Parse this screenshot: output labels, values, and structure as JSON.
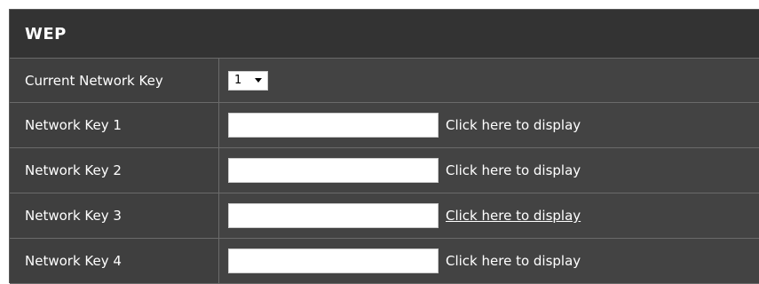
{
  "section": {
    "title": "WEP"
  },
  "current_key": {
    "label": "Current Network Key",
    "selected": "1"
  },
  "keys": [
    {
      "label": "Network Key 1",
      "value": "",
      "link": "Click here to display"
    },
    {
      "label": "Network Key 2",
      "value": "",
      "link": "Click here to display"
    },
    {
      "label": "Network Key 3",
      "value": "",
      "link": "Click here to display"
    },
    {
      "label": "Network Key 4",
      "value": "",
      "link": "Click here to display"
    }
  ],
  "colors": {
    "panel_bg": "#3f3f3f",
    "header_bg": "#333333",
    "text": "#ffffff",
    "divider": "#6a6a6a"
  }
}
